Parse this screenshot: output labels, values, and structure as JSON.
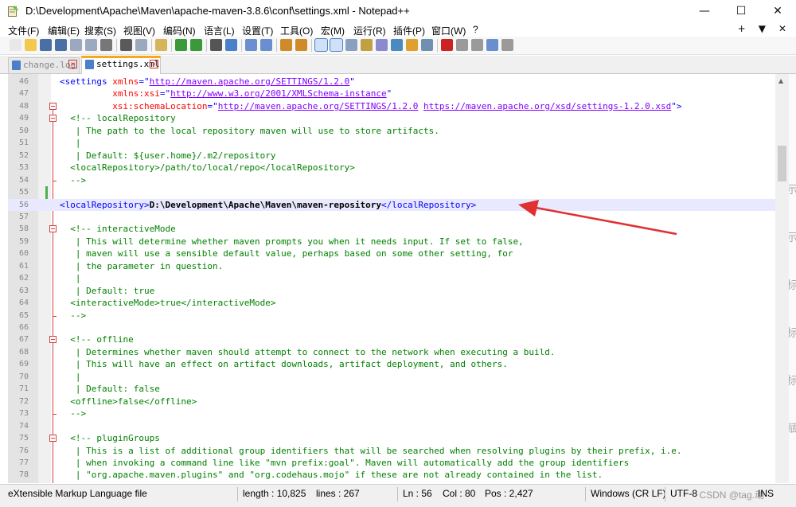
{
  "window": {
    "title": "D:\\Development\\Apache\\Maven\\apache-maven-3.8.6\\conf\\settings.xml - Notepad++",
    "controls": {
      "minimize": "—",
      "maximize": "☐",
      "close": "✕"
    }
  },
  "menu": {
    "items": [
      "文件(F)",
      "编辑(E)",
      "搜索(S)",
      "视图(V)",
      "编码(N)",
      "语言(L)",
      "设置(T)",
      "工具(O)",
      "宏(M)",
      "运行(R)",
      "插件(P)",
      "窗口(W)",
      "?"
    ],
    "right": [
      "+",
      "▼",
      "✕"
    ]
  },
  "toolbar": {
    "buttons": [
      "new",
      "open",
      "save",
      "save-all",
      "close",
      "close-all",
      "print",
      "cut",
      "copy",
      "paste",
      "undo",
      "redo",
      "find",
      "replace",
      "zoom-in",
      "zoom-out",
      "sync-v",
      "sync-h",
      "word-wrap",
      "all-chars",
      "indent-guide",
      "udl",
      "doc-map",
      "func-list",
      "folder-workspace",
      "monitor",
      "macro-record",
      "macro-stop",
      "macro-play",
      "macro-run-multiple",
      "macro-save"
    ]
  },
  "tabs": [
    {
      "label": "change.log",
      "active": false,
      "close": "✕"
    },
    {
      "label": "settings.xml",
      "active": true,
      "close": "✕"
    }
  ],
  "editor": {
    "lines": [
      {
        "n": "46",
        "parts": [
          [
            "c-tag",
            "<settings "
          ],
          [
            "c-attr",
            "xmlns"
          ],
          [
            "c-tag",
            "=\""
          ],
          [
            "c-val",
            "http://maven.apache.org/SETTINGS/1.2.0"
          ],
          [
            "c-tag",
            "\""
          ]
        ]
      },
      {
        "n": "47",
        "parts": [
          [
            "c-tag",
            "          "
          ],
          [
            "c-attr",
            "xmlns:xsi"
          ],
          [
            "c-tag",
            "=\""
          ],
          [
            "c-val",
            "http://www.w3.org/2001/XMLSchema-instance"
          ],
          [
            "c-tag",
            "\""
          ]
        ]
      },
      {
        "n": "48",
        "parts": [
          [
            "c-tag",
            "          "
          ],
          [
            "c-attr",
            "xsi:schemaLocation"
          ],
          [
            "c-tag",
            "=\""
          ],
          [
            "c-val",
            "http://maven.apache.org/SETTINGS/1.2.0"
          ],
          [
            "c-tag",
            " "
          ],
          [
            "c-val",
            "https://maven.apache.org/xsd/settings-1.2.0.xsd"
          ],
          [
            "c-tag",
            "\">"
          ]
        ]
      },
      {
        "n": "49",
        "parts": [
          [
            "c-cmt",
            "  <!-- localRepository"
          ]
        ]
      },
      {
        "n": "50",
        "parts": [
          [
            "c-cmt",
            "   | The path to the local repository maven will use to store artifacts."
          ]
        ]
      },
      {
        "n": "51",
        "parts": [
          [
            "c-cmt",
            "   |"
          ]
        ]
      },
      {
        "n": "52",
        "parts": [
          [
            "c-cmt",
            "   | Default: ${user.home}/.m2/repository"
          ]
        ]
      },
      {
        "n": "53",
        "parts": [
          [
            "c-cmt",
            "  <localRepository>/path/to/local/repo</localRepository>"
          ]
        ]
      },
      {
        "n": "54",
        "parts": [
          [
            "c-cmt",
            "  -->"
          ]
        ]
      },
      {
        "n": "55",
        "parts": []
      },
      {
        "n": "56",
        "parts": [
          [
            "c-tag",
            "<localRepository>"
          ],
          [
            "c-txt",
            "D:\\Development\\Apache\\Maven\\maven-repository"
          ],
          [
            "c-tag",
            "</localRepository>"
          ]
        ],
        "current": true
      },
      {
        "n": "57",
        "parts": []
      },
      {
        "n": "58",
        "parts": [
          [
            "c-cmt",
            "  <!-- interactiveMode"
          ]
        ]
      },
      {
        "n": "59",
        "parts": [
          [
            "c-cmt",
            "   | This will determine whether maven prompts you when it needs input. If set to false,"
          ]
        ]
      },
      {
        "n": "60",
        "parts": [
          [
            "c-cmt",
            "   | maven will use a sensible default value, perhaps based on some other setting, for"
          ]
        ]
      },
      {
        "n": "61",
        "parts": [
          [
            "c-cmt",
            "   | the parameter in question."
          ]
        ]
      },
      {
        "n": "62",
        "parts": [
          [
            "c-cmt",
            "   |"
          ]
        ]
      },
      {
        "n": "63",
        "parts": [
          [
            "c-cmt",
            "   | Default: true"
          ]
        ]
      },
      {
        "n": "64",
        "parts": [
          [
            "c-cmt",
            "  <interactiveMode>true</interactiveMode>"
          ]
        ]
      },
      {
        "n": "65",
        "parts": [
          [
            "c-cmt",
            "  -->"
          ]
        ]
      },
      {
        "n": "66",
        "parts": []
      },
      {
        "n": "67",
        "parts": [
          [
            "c-cmt",
            "  <!-- offline"
          ]
        ]
      },
      {
        "n": "68",
        "parts": [
          [
            "c-cmt",
            "   | Determines whether maven should attempt to connect to the network when executing a build."
          ]
        ]
      },
      {
        "n": "69",
        "parts": [
          [
            "c-cmt",
            "   | This will have an effect on artifact downloads, artifact deployment, and others."
          ]
        ]
      },
      {
        "n": "70",
        "parts": [
          [
            "c-cmt",
            "   |"
          ]
        ]
      },
      {
        "n": "71",
        "parts": [
          [
            "c-cmt",
            "   | Default: false"
          ]
        ]
      },
      {
        "n": "72",
        "parts": [
          [
            "c-cmt",
            "  <offline>false</offline>"
          ]
        ]
      },
      {
        "n": "73",
        "parts": [
          [
            "c-cmt",
            "  -->"
          ]
        ]
      },
      {
        "n": "74",
        "parts": []
      },
      {
        "n": "75",
        "parts": [
          [
            "c-cmt",
            "  <!-- pluginGroups"
          ]
        ]
      },
      {
        "n": "76",
        "parts": [
          [
            "c-cmt",
            "   | This is a list of additional group identifiers that will be searched when resolving plugins by their prefix, i.e."
          ]
        ]
      },
      {
        "n": "77",
        "parts": [
          [
            "c-cmt",
            "   | when invoking a command line like \"mvn prefix:goal\". Maven will automatically add the group identifiers"
          ]
        ]
      },
      {
        "n": "78",
        "parts": [
          [
            "c-cmt",
            "   | \"org.apache.maven.plugins\" and \"org.codehaus.mojo\" if these are not already contained in the list."
          ]
        ]
      }
    ]
  },
  "status": {
    "filetype": "eXtensible Markup Language file",
    "length": "length : 10,825",
    "lines": "lines : 267",
    "ln": "Ln : 56",
    "col": "Col : 80",
    "pos": "Pos : 2,427",
    "eol": "Windows (CR LF)",
    "encoding": "UTF-8",
    "mode": "INS",
    "watermark": "CSDN @tag.动"
  },
  "colors": {
    "tag": "#0000ff",
    "attr": "#ff0000",
    "value": "#8000ff",
    "comment": "#008000",
    "current_line": "#e8e8ff",
    "annotation_arrow": "#e03030"
  },
  "strip_chars": [
    "示",
    "示",
    "标",
    "标",
    "标",
    "赋"
  ]
}
